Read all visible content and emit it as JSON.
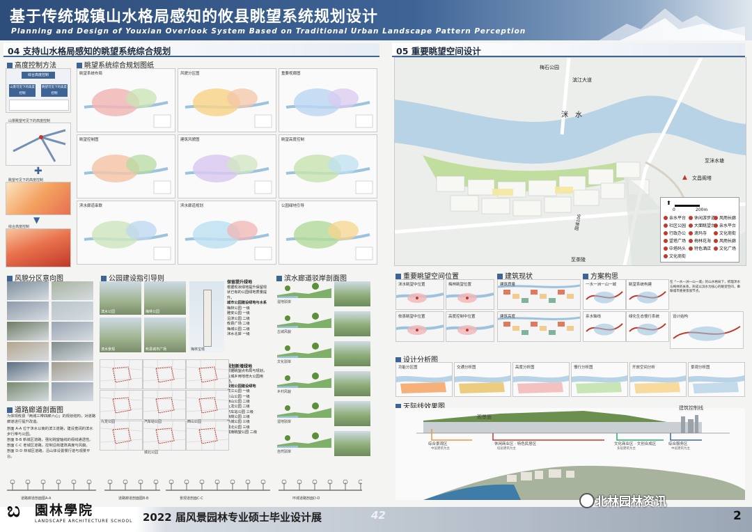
{
  "header": {
    "title_cn": "基于传统城镇山水格局感知的攸县眺望系统规划设计",
    "title_en": "Planning and Design of Youxian Overlook System Based on Traditional Urban Landscape Pattern Perception"
  },
  "section04": {
    "title": "04 支持山水格局感知的眺望系统综合规划",
    "height_control": {
      "title": "高度控制方法",
      "box_top": "综合高度控制",
      "box_left": "山景可见下的高度控制",
      "box_right": "眺望可见下的高度控制",
      "label_a": "山景眺望可见下的高度控制",
      "label_b": "眺望可见下的高度控制",
      "label_c": "综合高度控制"
    },
    "overview": {
      "title": "眺望系统综合规划图纸",
      "panels": [
        "眺望系统布局",
        "风貌分区图",
        "重要视廊图",
        "眺望控制图",
        "建筑风貌图",
        "眺望高度控制",
        "滨水廊道串联",
        "滨水廊道规划",
        "公园绿地引导"
      ]
    },
    "style_zone": {
      "title": "风貌分区意向图"
    },
    "park": {
      "title": "公园建设指引导则",
      "group1": {
        "title": "保留提升绿地",
        "desc": "根据现状绿地提升保留现状已有的公园绿地质量提升。",
        "list_head": "城市公园建设绿地与水系",
        "items": [
          "梅林公园 一级",
          "雅安公园 一级",
          "沿洣公园 二级",
          "攸县广场 二级",
          "梅城公园 二级",
          "洣水北岸 一级"
        ]
      },
      "group2": {
        "title": "规划新增绿地",
        "desc": "根据眺望点布局与规划，在城乡用地增大公园用地。",
        "list_head": "规划公园建设绿地",
        "items": [
          "滨江公园 一级",
          "东山公园 一级",
          "西山公园 二级",
          "九龙公园 二级",
          "汽车站公园 三级",
          "西岗公园 三级",
          "新城公园 三级",
          "城北公园 三级",
          "城南眺望公园 二级"
        ]
      },
      "photo_labels": [
        "滨水公园",
        "梅林公园",
        "滨水景观",
        "攸县城市广场",
        "梅林宝塔"
      ],
      "map_labels": [
        "九龙公园",
        "汽车站公园",
        "西山公园",
        "城北公园"
      ]
    },
    "riverside": {
      "title": "滨水廊道驳岸剖面图",
      "labels": [
        "湿地驳岸",
        "古城风貌",
        "文化驳岸",
        "乡村风貌",
        "湿地驳岸",
        "自然驳岸"
      ]
    },
    "road": {
      "title": "道路廊道剖面图",
      "intro": "为体现攸县「两城三带四廊六心」的规划结构，对道路廊道进行提升改造。",
      "items": [
        "剖面 A-A 位于洣水以南的滨江道路，建设宽阔的滨水步行带与公园。",
        "剖面 B-B 新城区道路，强化眺望轴线的视线通透性。",
        "剖面 C-C 老城区道路，控制沿街建筑高度与风貌。",
        "剖面 D-D 林城区道路，沿山体设置慢行道与观景平台。"
      ],
      "section_labels": [
        "道路廊道剖面图A-A",
        "道路廊道剖面图B-B",
        "景观道剖面C-C",
        "环城道路剖面D-D"
      ]
    }
  },
  "section05": {
    "title": "05 重要眺望空间设计",
    "map_labels": [
      "梅石公园",
      "滨江大道",
      "洣　水",
      "至洣水塘",
      "文昌阁塔",
      "国道106",
      "至茶陵"
    ],
    "scale": "200m",
    "scale_zero": "0",
    "legend": [
      "亲水平台",
      "休闲游步道",
      "风雨长廊",
      "社区公园",
      "大面眺望台",
      "亲水平台",
      "行政办公",
      "滴玛寺",
      "文化商街",
      "望塔广场",
      "梅林花海",
      "风雨长廊",
      "中塔码头",
      "特色酒店",
      "文化广场",
      "文化商街"
    ],
    "viewpoint": {
      "title": "重要眺望空间位置",
      "labels": [
        "洣水眺望中位置",
        "梅林眺望位置",
        "攸县眺望中位置",
        "高度控制中位置"
      ]
    },
    "status": {
      "title": "建筑现状",
      "labels": [
        "建筑质量",
        "建筑高度"
      ]
    },
    "concept": {
      "title": "方案构思",
      "labels": [
        "一水一洲一山一城",
        "眺望系统构建",
        "亲水轴线",
        "绿化生态慢行系统",
        "设计结构"
      ],
      "desc": "在「一水一洲一山一城」的山水格局下，梳理洣水与梅林的关系，形成以滨水为核心的眺望空间，串联城市重要景观节点。"
    },
    "analysis": {
      "title": "设计分析图",
      "labels": [
        "功能分区图",
        "交通分析图",
        "高度分析图",
        "慢行分析图",
        "开放空间分析",
        "景观分析图"
      ]
    },
    "skyline": {
      "title": "天际线效果图",
      "labels": [
        "观景面",
        "建筑控制线"
      ],
      "zones": [
        "综合景观区",
        "休闲商业区 · 特色民居区",
        "文化商业区 · 文创合成区",
        "综合服务区"
      ],
      "zone_notes": [
        "中层建筑为主",
        "低层建筑为主",
        "多层建筑为主",
        "中层建筑为主"
      ]
    }
  },
  "footer": {
    "school_cn": "園林學院",
    "school_en": "LANDSCAPE ARCHITECTURE SCHOOL",
    "exhibit": "2022 届风景园林专业硕士毕业设计展",
    "board_no": "42",
    "page_no": "2",
    "wechat": "北林园林资讯"
  },
  "colors": {
    "header": "#3e6496",
    "accent_red": "#c0392b",
    "river": "#b9d3e6",
    "green": "#b7d98b"
  }
}
